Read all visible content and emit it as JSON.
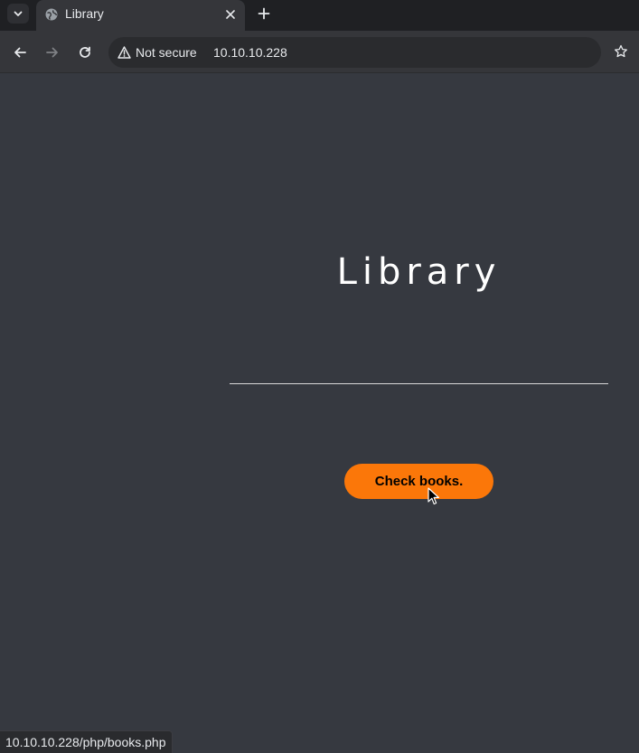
{
  "browser": {
    "tab": {
      "title": "Library",
      "favicon": "globe-icon"
    },
    "toolbar": {
      "security_label": "Not secure",
      "url": "10.10.10.228"
    },
    "status_url": "10.10.10.228/php/books.php"
  },
  "page": {
    "title": "Library",
    "check_button_label": "Check books."
  },
  "colors": {
    "page_background": "#363940",
    "button_background": "#fb7709",
    "title_color": "#ffffff"
  }
}
